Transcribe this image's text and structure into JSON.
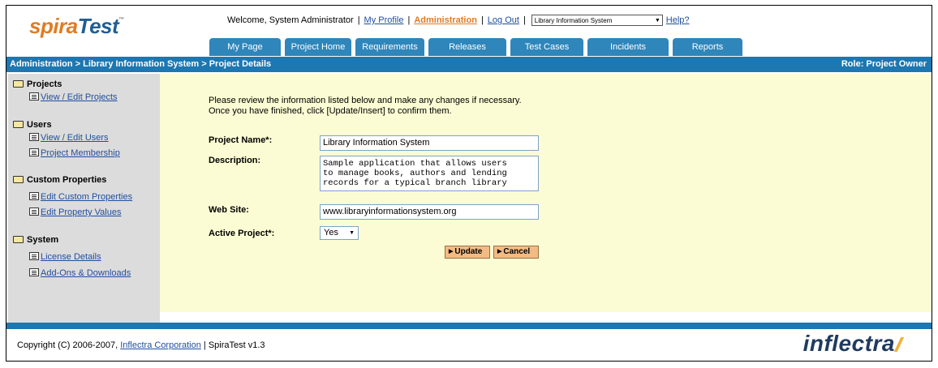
{
  "brand": {
    "logo_part1": "spira",
    "logo_part2": "Test",
    "tm": "™"
  },
  "top_bar": {
    "welcome": "Welcome, System Administrator",
    "my_profile": "My Profile",
    "administration": "Administration",
    "logout": "Log Out",
    "project_select": "Library Information System",
    "help": "Help?"
  },
  "tabs": [
    "My Page",
    "Project Home",
    "Requirements",
    "Releases",
    "Test Cases",
    "Incidents",
    "Reports"
  ],
  "breadcrumb": "Administration > Library Information System > Project Details",
  "role": "Role: Project Owner",
  "sidebar": {
    "groups": [
      {
        "label": "Projects",
        "links": [
          "View / Edit Projects"
        ]
      },
      {
        "label": "Users",
        "links": [
          "View / Edit Users",
          "Project Membership"
        ]
      },
      {
        "label": "Custom Properties",
        "links": [
          "Edit Custom Properties",
          "Edit Property Values"
        ]
      },
      {
        "label": "System",
        "links": [
          "License Details",
          "Add-Ons & Downloads"
        ]
      }
    ]
  },
  "form": {
    "intro_line1": "Please review the information listed below and make any changes if necessary.",
    "intro_line2": "Once you have finished, click [Update/Insert] to confirm them.",
    "project_name_label": "Project Name*:",
    "project_name_value": "Library Information System",
    "description_label": "Description:",
    "description_lines": [
      "Sample application that allows users",
      "to manage books, authors and lending",
      "records for a typical branch library"
    ],
    "website_label": "Web Site:",
    "website_value": "www.libraryinformationsystem.org",
    "active_label": "Active Project*:",
    "active_value": "Yes",
    "update_button": "Update",
    "cancel_button": "Cancel"
  },
  "footer": {
    "copyright_prefix": "Copyright (C) 2006-2007,",
    "company": "Inflectra Corporation",
    "version": "| SpiraTest v1.3",
    "brand": "inflectra"
  },
  "colors": {
    "header_blue": "#1d77b0",
    "tab_blue": "#2e86bb",
    "form_bg": "#fcfcd4",
    "sidebar_bg": "#dcdcdc",
    "accent_orange": "#e07b22"
  }
}
